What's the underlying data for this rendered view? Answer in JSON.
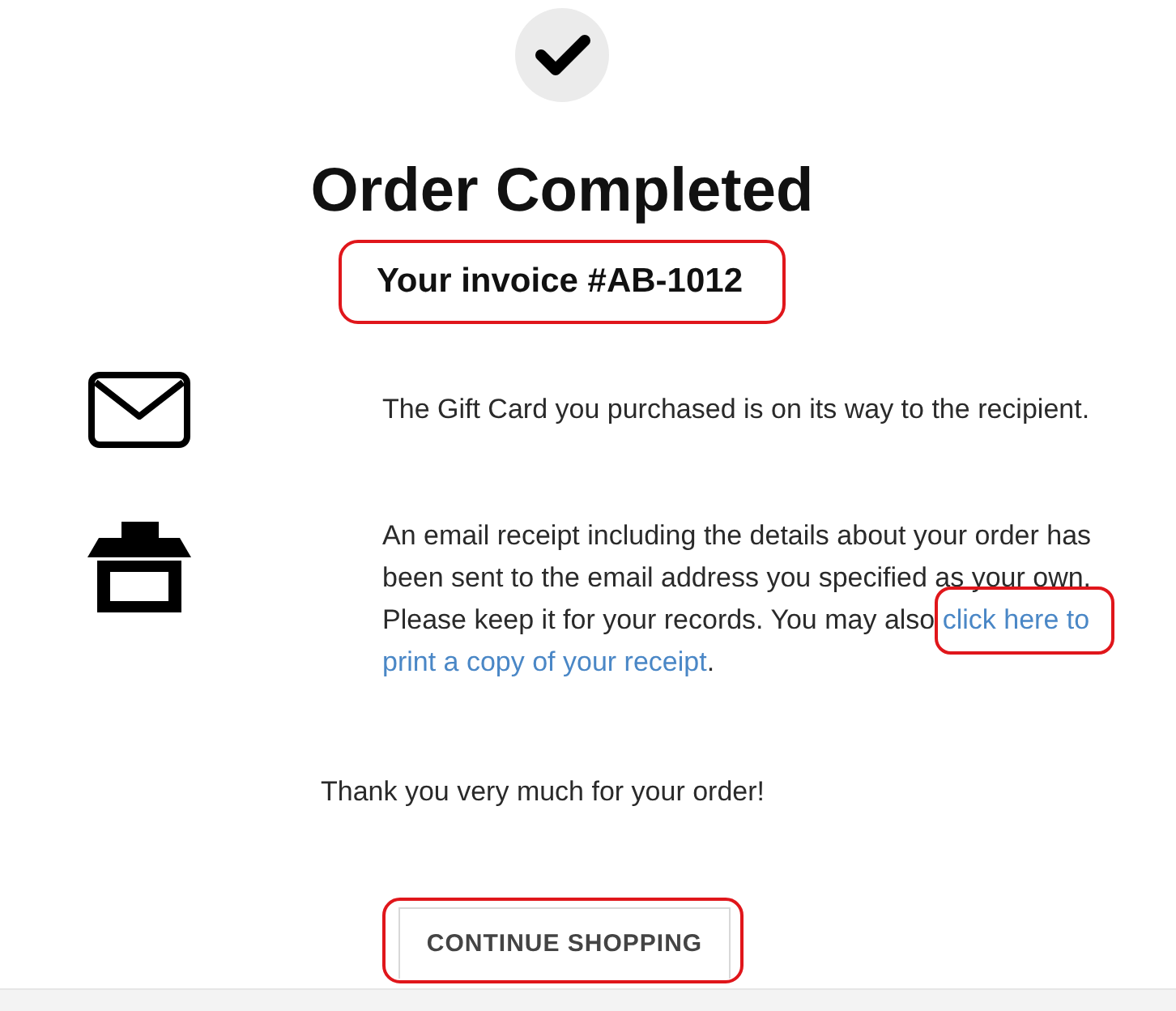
{
  "header": {
    "title": "Order Completed",
    "invoice": "Your invoice #AB-1012",
    "invoice_highlighted": true
  },
  "messages": [
    {
      "text": "The Gift Card you purchased is on its way to the recipient."
    },
    {
      "text": "An email receipt including the details about your order has been sent to the email address you specified as your own. Please keep it for your records. You may also",
      "link_lines": [
        "click here to",
        "print a copy of your receipt"
      ],
      "link_highlighted": true,
      "text_after": "."
    }
  ],
  "closing": "Thank you very much for your order!",
  "button": {
    "label": "CONTINUE SHOPPING",
    "highlighted": true
  }
}
